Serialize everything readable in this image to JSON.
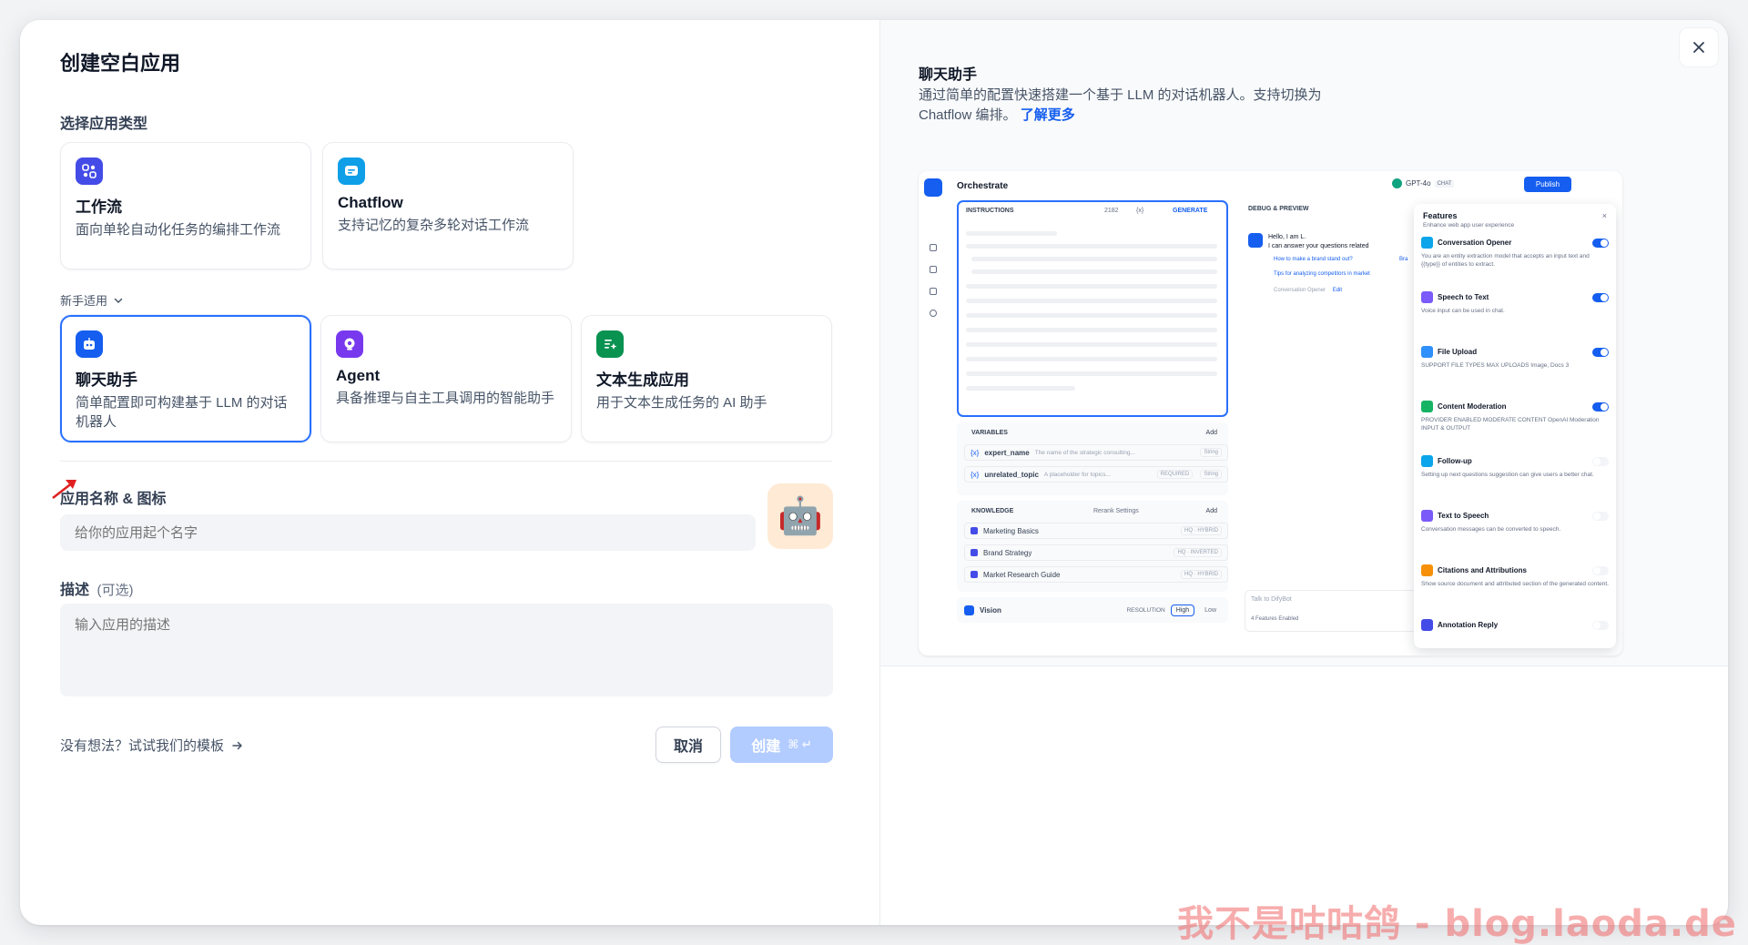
{
  "dialog": {
    "title": "创建空白应用",
    "close_icon": "close-icon"
  },
  "app_type": {
    "label": "选择应用类型",
    "cards": [
      {
        "name": "工作流",
        "desc": "面向单轮自动化任务的编排工作流",
        "icon": "workflow-icon",
        "color": "#444ce7"
      },
      {
        "name": "Chatflow",
        "desc": "支持记忆的复杂多轮对话工作流",
        "icon": "chatflow-icon",
        "color": "#0e9fe8"
      }
    ],
    "beginner_label": "新手适用",
    "beginner_cards": [
      {
        "name": "聊天助手",
        "desc": "简单配置即可构建基于 LLM 的对话机器人",
        "icon": "chatbot-icon",
        "color": "#155eef",
        "selected": true
      },
      {
        "name": "Agent",
        "desc": "具备推理与自主工具调用的智能助手",
        "icon": "agent-icon",
        "color": "#7839ee"
      },
      {
        "name": "文本生成应用",
        "desc": "用于文本生成任务的 AI 助手",
        "icon": "text-generator-icon",
        "color": "#099250"
      }
    ]
  },
  "app_name": {
    "label": "应用名称 & 图标",
    "placeholder": "给你的应用起个名字",
    "avatar": "🤖"
  },
  "description": {
    "label": "描述",
    "optional": "(可选)",
    "placeholder": "输入应用的描述"
  },
  "footer": {
    "template_link": "没有想法？试试我们的模板",
    "cancel": "取消",
    "create": "创建"
  },
  "preview": {
    "title": "聊天助手",
    "desc_line1": "通过简单的配置快速搭建一个基于 LLM 的对话机器人。支持切换为",
    "desc_line2": "Chatflow 编排。",
    "learn_more": "了解更多",
    "mock": {
      "orchestrate": "Orchestrate",
      "model": "GPT-4o",
      "chat_tag": "CHAT",
      "publish": "Publish",
      "instructions": "INSTRUCTIONS",
      "count": "2182",
      "var_icon": "{x}",
      "generate": "GENERATE",
      "debug": "DEBUG & PREVIEW",
      "hello1": "Hello, I am L.",
      "hello2": "I can answer your questions related",
      "sugg1": "How to make a brand stand out?",
      "sugg2": "Tips for analyzing competitors in market",
      "sugg_tail": "Bra",
      "opener": "Conversation Opener",
      "opener_edit": "Edit",
      "variables": "VARIABLES",
      "add": "Add",
      "var1_name": "expert_name",
      "var1_desc": "The name of the strategic consulting...",
      "var2_name": "unrelated_topic",
      "var2_desc": "A placeholder for topics...",
      "required": "REQUIRED",
      "string": "String",
      "knowledge": "KNOWLEDGE",
      "rerank": "Rerank Settings",
      "kb": [
        "Marketing Basics",
        "Brand Strategy",
        "Market Research Guide"
      ],
      "kb_tag": [
        "HQ · HYBRID",
        "HQ · INVERTED",
        "HQ · HYBRID"
      ],
      "vision": "Vision",
      "resolution": "RESOLUTION",
      "high": "High",
      "low": "Low",
      "chat_placeholder": "Talk to DifyBot",
      "features_enabled": "4 Features Enabled",
      "features": {
        "title": "Features",
        "subtitle": "Enhance web app user experience",
        "items": [
          {
            "name": "Conversation Opener",
            "desc": "You are an entity extraction model that accepts an input text and {{type}} of entities to extract.",
            "on": true,
            "color": "#0ba5ec"
          },
          {
            "name": "Speech to Text",
            "desc": "Voice input can be used in chat.",
            "on": true,
            "color": "#7a5af8"
          },
          {
            "name": "File Upload",
            "desc": "SUPPORT FILE TYPES    MAX UPLOADS   Image, Docs    3",
            "on": true,
            "color": "#2e90fa"
          },
          {
            "name": "Content Moderation",
            "desc": "PROVIDER    ENABLED MODERATE CONTENT   OpenAI Moderation    INPUT & OUTPUT",
            "on": true,
            "color": "#16b364"
          },
          {
            "name": "Follow-up",
            "desc": "Setting up next questions suggestion can give users a better chat.",
            "on": false,
            "color": "#0ba5ec"
          },
          {
            "name": "Text to Speech",
            "desc": "Conversation messages can be converted to speech.",
            "on": false,
            "color": "#7a5af8"
          },
          {
            "name": "Citations and Attributions",
            "desc": "Show source document and attributed section of the generated content.",
            "on": false,
            "color": "#f79009"
          },
          {
            "name": "Annotation Reply",
            "desc": "",
            "on": false,
            "color": "#444ce7"
          }
        ]
      }
    }
  },
  "watermark": "我不是咕咕鸽 - blog.laoda.de"
}
